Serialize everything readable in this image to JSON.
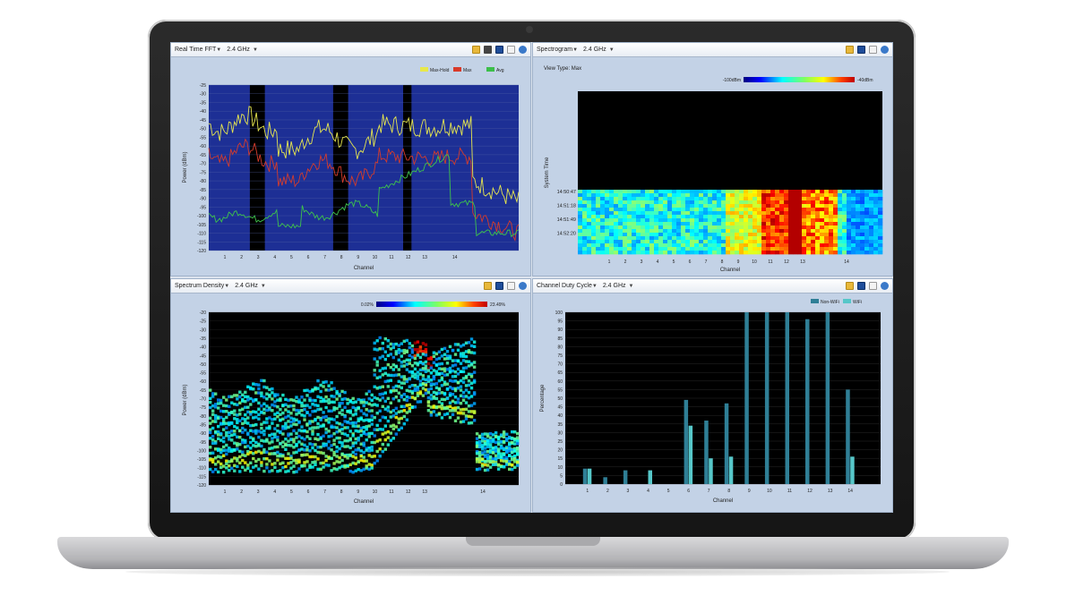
{
  "panels": {
    "fft": {
      "title": "Real Time FFT",
      "band": "2.4 GHz",
      "legend": [
        {
          "name": "Max-Hold",
          "color": "#e8e84a"
        },
        {
          "name": "Max",
          "color": "#d83a2a"
        },
        {
          "name": "Avg",
          "color": "#3cbf4a"
        }
      ],
      "ylabel": "Power (dBm)",
      "xlabel": "Channel",
      "yticks": [
        "-25",
        "-30",
        "-35",
        "-40",
        "-45",
        "-50",
        "-55",
        "-60",
        "-65",
        "-70",
        "-75",
        "-80",
        "-85",
        "-90",
        "-95",
        "-100",
        "-105",
        "-110",
        "-115",
        "-120"
      ],
      "xticks": [
        "1",
        "2",
        "3",
        "4",
        "5",
        "6",
        "7",
        "8",
        "9",
        "10",
        "11",
        "12",
        "13",
        "14"
      ]
    },
    "spectrogram": {
      "title": "Spectrogram",
      "band": "2.4 GHz",
      "view_type": "View Type: Max",
      "scale_min": "-100dBm",
      "scale_max": "-40dBm",
      "ylabel": "System Time",
      "time_ticks": [
        "14:50:47",
        "14:51:18",
        "14:51:49",
        "14:52:20"
      ],
      "xlabel": "Channel",
      "xticks": [
        "1",
        "2",
        "3",
        "4",
        "5",
        "6",
        "7",
        "8",
        "9",
        "10",
        "11",
        "12",
        "13",
        "14"
      ]
    },
    "density": {
      "title": "Spectrum Density",
      "band": "2.4 GHz",
      "scale_min": "0.02%",
      "scale_max": "23.49%",
      "ylabel": "Power (dBm)",
      "xlabel": "Channel",
      "yticks": [
        "-20",
        "-25",
        "-30",
        "-35",
        "-40",
        "-45",
        "-50",
        "-55",
        "-60",
        "-65",
        "-70",
        "-75",
        "-80",
        "-85",
        "-90",
        "-95",
        "-100",
        "-105",
        "-110",
        "-115",
        "-120"
      ],
      "xticks": [
        "1",
        "2",
        "3",
        "4",
        "5",
        "6",
        "7",
        "8",
        "9",
        "10",
        "11",
        "12",
        "13",
        "14"
      ]
    },
    "duty": {
      "title": "Channel Duty Cycle",
      "band": "2.4 GHz",
      "legend": [
        {
          "name": "Non-WiFi",
          "color": "#2f7f96"
        },
        {
          "name": "WiFi",
          "color": "#56c7c9"
        }
      ],
      "ylabel": "Percentage",
      "xlabel": "Channel",
      "yticks": [
        "100",
        "95",
        "90",
        "85",
        "80",
        "75",
        "70",
        "65",
        "60",
        "55",
        "50",
        "45",
        "40",
        "35",
        "30",
        "25",
        "20",
        "15",
        "10",
        "5",
        "0"
      ],
      "xticks": [
        "1",
        "2",
        "3",
        "4",
        "5",
        "6",
        "7",
        "8",
        "9",
        "10",
        "11",
        "12",
        "13",
        "14"
      ]
    }
  },
  "chart_data": [
    {
      "type": "bar",
      "title": "Channel Duty Cycle",
      "xlabel": "Channel",
      "ylabel": "Percentage",
      "ylim": [
        0,
        100
      ],
      "categories": [
        "1",
        "2",
        "3",
        "4",
        "5",
        "6",
        "7",
        "8",
        "9",
        "10",
        "11",
        "12",
        "13",
        "14"
      ],
      "series": [
        {
          "name": "Non-WiFi",
          "values": [
            9,
            4,
            8,
            0,
            0,
            49,
            37,
            47,
            100,
            100,
            100,
            96,
            100,
            55
          ]
        },
        {
          "name": "WiFi",
          "values": [
            9,
            0,
            0,
            8,
            0,
            34,
            15,
            16,
            0,
            0,
            0,
            0,
            0,
            16
          ]
        }
      ],
      "legend": "top-right",
      "grid": true
    }
  ]
}
